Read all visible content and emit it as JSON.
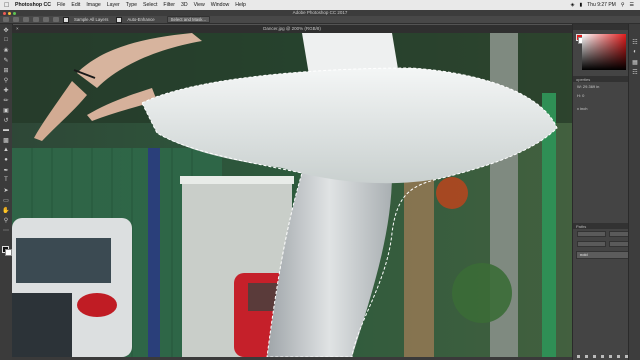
{
  "menubar": {
    "apple": "",
    "app": "Photoshop CC",
    "items": [
      "File",
      "Edit",
      "Image",
      "Layer",
      "Type",
      "Select",
      "Filter",
      "3D",
      "View",
      "Window",
      "Help"
    ],
    "clock": "Thu 9:27 PM"
  },
  "window": {
    "title": "Adobe Photoshop CC 2017"
  },
  "options": {
    "sample_all_layers": "Sample All Layers",
    "auto_enhance": "Auto-Enhance",
    "select_and_mask": "Select and Mask..."
  },
  "document": {
    "tab": "Dancer.jpg @ 200% (RGB/8)",
    "close": "×"
  },
  "panels": {
    "color_tab": "",
    "properties_tab": "operties",
    "properties_w": "W: 29.369 in",
    "properties_h": "H: 0",
    "properties_x": "x inch",
    "layers_tab": "Paths",
    "layers_mode": "Normal",
    "opacity_label": "Opacity",
    "fill_label": "Fill",
    "layer_name": "nold"
  },
  "colors": {
    "accent_red": "#e21d1d",
    "fill_green": "#2f4a38"
  }
}
